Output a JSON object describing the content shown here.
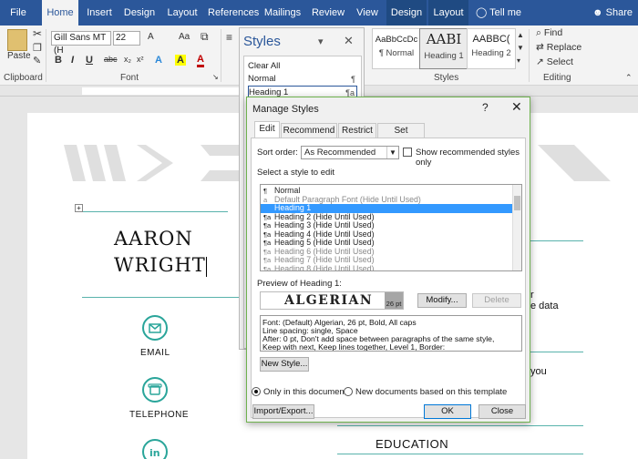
{
  "ribbon": {
    "tabs": [
      "File",
      "Home",
      "Insert",
      "Design",
      "Layout",
      "References",
      "Mailings",
      "Review",
      "View",
      "Design",
      "Layout"
    ],
    "tell_me": "Tell me",
    "share": "Share",
    "clipboard": {
      "paste": "Paste",
      "label": "Clipboard"
    },
    "font": {
      "name": "Gill Sans MT (H",
      "size": "22",
      "label": "Font",
      "bold": "B",
      "italic": "I",
      "underline": "U",
      "strike": "abc",
      "sub": "x₂",
      "sup": "x²",
      "aa": "Aa",
      "grow": "A",
      "highlight": "A"
    },
    "styles_gallery": [
      {
        "sample": "AaBbCcDc",
        "name": "¶ Normal"
      },
      {
        "sample": "AABI",
        "name": "Heading 1"
      },
      {
        "sample": "AABBC(",
        "name": "Heading 2"
      }
    ],
    "styles_label": "Styles",
    "editing": {
      "find": "Find",
      "replace": "Replace",
      "select": "Select",
      "label": "Editing"
    }
  },
  "styles_pane": {
    "title": "Styles",
    "items": [
      {
        "label": "Clear All",
        "marker": ""
      },
      {
        "label": "Normal",
        "marker": "¶"
      },
      {
        "label": "Heading 1",
        "marker": "¶a"
      }
    ]
  },
  "document": {
    "name_line1": "AARON",
    "name_line2": "WRIGHT",
    "email_label": "EMAIL",
    "telephone_label": "TELEPHONE",
    "education": "EDUCATION",
    "frag_r": "r",
    "frag_data": "e data",
    "frag_you": "you"
  },
  "dialog": {
    "title": "Manage Styles",
    "help": "?",
    "tabs": [
      "Edit",
      "Recommend",
      "Restrict",
      "Set Defaults"
    ],
    "sort_order_label": "Sort order:",
    "sort_order_value": "As Recommended",
    "show_recommended": "Show recommended styles only",
    "select_label": "Select a style to edit",
    "style_list": [
      {
        "glyph": "¶",
        "label": "Normal",
        "state": "normal"
      },
      {
        "glyph": "a",
        "label": "Default Paragraph Font  (Hide Until Used)",
        "state": "muted"
      },
      {
        "glyph": "",
        "label": "Heading 1",
        "state": "selected"
      },
      {
        "glyph": "¶a",
        "label": "Heading 2  (Hide Until Used)",
        "state": "normal"
      },
      {
        "glyph": "¶a",
        "label": "Heading 3  (Hide Until Used)",
        "state": "normal"
      },
      {
        "glyph": "¶a",
        "label": "Heading 4  (Hide Until Used)",
        "state": "normal"
      },
      {
        "glyph": "¶a",
        "label": "Heading 5  (Hide Until Used)",
        "state": "normal"
      },
      {
        "glyph": "¶a",
        "label": "Heading 6  (Hide Until Used)",
        "state": "muted"
      },
      {
        "glyph": "¶a",
        "label": "Heading 7  (Hide Until Used)",
        "state": "muted"
      },
      {
        "glyph": "¶a",
        "label": "Heading 8  (Hide Until Used)",
        "state": "muted"
      }
    ],
    "preview_label": "Preview of Heading 1:",
    "preview_text": "ALGERIAN",
    "preview_size": "26 pt",
    "modify": "Modify...",
    "delete": "Delete",
    "description": [
      "Font: (Default) Algerian, 26 pt, Bold, All caps",
      "    Line spacing:  single, Space",
      "    After:  0 pt, Don't add space between paragraphs of the same style,",
      "Keep with next, Keep lines together, Level 1, Border:"
    ],
    "new_style": "New Style...",
    "only_doc": "Only in this document",
    "new_docs": "New documents based on this template",
    "import_export": "Import/Export...",
    "ok": "OK",
    "close": "Close"
  },
  "colors": {
    "ribbon_blue": "#2b579a",
    "teal": "#2aa59a",
    "dialog_border": "#6fb24f",
    "selection": "#3399ff"
  }
}
